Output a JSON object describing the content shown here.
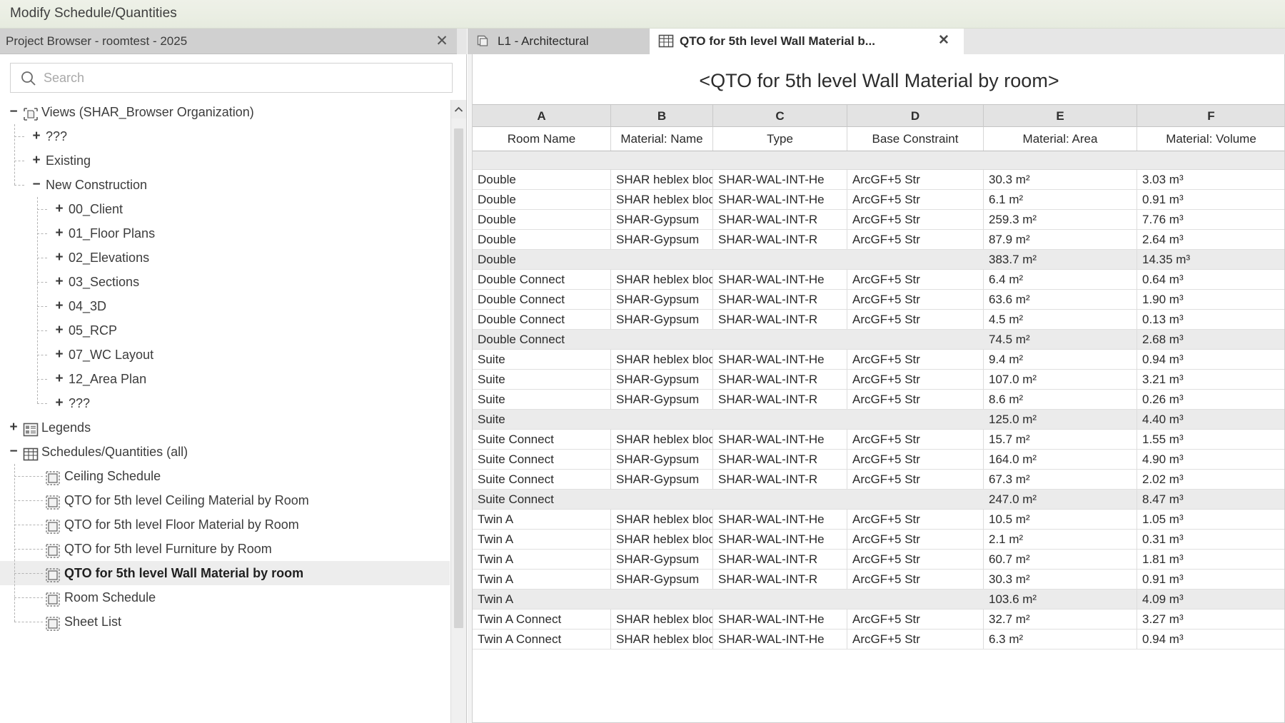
{
  "ribbon": {
    "title": "Modify Schedule/Quantities"
  },
  "browser": {
    "title": "Project Browser - roomtest - 2025",
    "close_label": "✕",
    "search": {
      "placeholder": "Search",
      "value": ""
    },
    "tree": [
      {
        "label": "Views (SHAR_Browser Organization)",
        "expander": "−",
        "depth": 0,
        "icon": "views-icon"
      },
      {
        "label": "???",
        "expander": "+",
        "depth": 1,
        "icon": "none"
      },
      {
        "label": "Existing",
        "expander": "+",
        "depth": 1,
        "icon": "none"
      },
      {
        "label": "New Construction",
        "expander": "−",
        "depth": 1,
        "icon": "none"
      },
      {
        "label": "00_Client",
        "expander": "+",
        "depth": 2,
        "icon": "none"
      },
      {
        "label": "01_Floor Plans",
        "expander": "+",
        "depth": 2,
        "icon": "none"
      },
      {
        "label": "02_Elevations",
        "expander": "+",
        "depth": 2,
        "icon": "none"
      },
      {
        "label": "03_Sections",
        "expander": "+",
        "depth": 2,
        "icon": "none"
      },
      {
        "label": "04_3D",
        "expander": "+",
        "depth": 2,
        "icon": "none"
      },
      {
        "label": "05_RCP",
        "expander": "+",
        "depth": 2,
        "icon": "none"
      },
      {
        "label": "07_WC Layout",
        "expander": "+",
        "depth": 2,
        "icon": "none"
      },
      {
        "label": "12_Area Plan",
        "expander": "+",
        "depth": 2,
        "icon": "none"
      },
      {
        "label": "???",
        "expander": "+",
        "depth": 2,
        "icon": "none"
      },
      {
        "label": "Legends",
        "expander": "+",
        "depth": 0,
        "icon": "legend-icon"
      },
      {
        "label": "Schedules/Quantities (all)",
        "expander": "−",
        "depth": 0,
        "icon": "schedule-icon"
      },
      {
        "label": "Ceiling Schedule",
        "expander": "",
        "depth": 1,
        "icon": "sheet-icon"
      },
      {
        "label": "QTO for 5th level Ceiling Material by Room",
        "expander": "",
        "depth": 1,
        "icon": "sheet-icon"
      },
      {
        "label": "QTO for 5th level Floor Material by Room",
        "expander": "",
        "depth": 1,
        "icon": "sheet-icon"
      },
      {
        "label": "QTO for 5th level Furniture by Room",
        "expander": "",
        "depth": 1,
        "icon": "sheet-icon"
      },
      {
        "label": "QTO for 5th level Wall Material by room",
        "expander": "",
        "depth": 1,
        "icon": "sheet-icon",
        "selected": true
      },
      {
        "label": "Room Schedule",
        "expander": "",
        "depth": 1,
        "icon": "sheet-icon"
      },
      {
        "label": "Sheet List",
        "expander": "",
        "depth": 1,
        "icon": "sheet-icon"
      }
    ]
  },
  "tabs": [
    {
      "label": "L1 - Architectural",
      "icon": "view-sheet-icon",
      "active": false,
      "closable": false
    },
    {
      "label": "QTO for 5th level Wall Material b...",
      "icon": "schedule-grid-icon",
      "active": true,
      "closable": true,
      "close_label": "✕"
    }
  ],
  "schedule": {
    "title": "<QTO for 5th level Wall Material by room>",
    "column_letters": [
      "A",
      "B",
      "C",
      "D",
      "E",
      "F"
    ],
    "columns": [
      "Room Name",
      "Material: Name",
      "Type",
      "Base Constraint",
      "Material: Area",
      "Material: Volume"
    ],
    "rows": [
      {
        "type": "data",
        "cells": [
          "Double",
          "SHAR heblex block",
          "SHAR-WAL-INT-He",
          "ArcGF+5 Str",
          "30.3 m²",
          "3.03 m³"
        ]
      },
      {
        "type": "data",
        "cells": [
          "Double",
          "SHAR heblex block",
          "SHAR-WAL-INT-He",
          "ArcGF+5 Str",
          "6.1 m²",
          "0.91 m³"
        ]
      },
      {
        "type": "data",
        "cells": [
          "Double",
          "SHAR-Gypsum",
          "SHAR-WAL-INT-R",
          "ArcGF+5 Str",
          "259.3 m²",
          "7.76 m³"
        ]
      },
      {
        "type": "data",
        "cells": [
          "Double",
          "SHAR-Gypsum",
          "SHAR-WAL-INT-R",
          "ArcGF+5 Str",
          "87.9 m²",
          "2.64 m³"
        ]
      },
      {
        "type": "subtotal",
        "cells": [
          "Double",
          "",
          "",
          "",
          "383.7 m²",
          "14.35 m³"
        ]
      },
      {
        "type": "data",
        "cells": [
          "Double Connect",
          "SHAR heblex block",
          "SHAR-WAL-INT-He",
          "ArcGF+5 Str",
          "6.4 m²",
          "0.64 m³"
        ]
      },
      {
        "type": "data",
        "cells": [
          "Double Connect",
          "SHAR-Gypsum",
          "SHAR-WAL-INT-R",
          "ArcGF+5 Str",
          "63.6 m²",
          "1.90 m³"
        ]
      },
      {
        "type": "data",
        "cells": [
          "Double Connect",
          "SHAR-Gypsum",
          "SHAR-WAL-INT-R",
          "ArcGF+5 Str",
          "4.5 m²",
          "0.13 m³"
        ]
      },
      {
        "type": "subtotal",
        "cells": [
          "Double Connect",
          "",
          "",
          "",
          "74.5 m²",
          "2.68 m³"
        ]
      },
      {
        "type": "data",
        "cells": [
          "Suite",
          "SHAR heblex block",
          "SHAR-WAL-INT-He",
          "ArcGF+5 Str",
          "9.4 m²",
          "0.94 m³"
        ]
      },
      {
        "type": "data",
        "cells": [
          "Suite",
          "SHAR-Gypsum",
          "SHAR-WAL-INT-R",
          "ArcGF+5 Str",
          "107.0 m²",
          "3.21 m³"
        ]
      },
      {
        "type": "data",
        "cells": [
          "Suite",
          "SHAR-Gypsum",
          "SHAR-WAL-INT-R",
          "ArcGF+5 Str",
          "8.6 m²",
          "0.26 m³"
        ]
      },
      {
        "type": "subtotal",
        "cells": [
          "Suite",
          "",
          "",
          "",
          "125.0 m²",
          "4.40 m³"
        ]
      },
      {
        "type": "data",
        "cells": [
          "Suite Connect",
          "SHAR heblex block",
          "SHAR-WAL-INT-He",
          "ArcGF+5 Str",
          "15.7 m²",
          "1.55 m³"
        ]
      },
      {
        "type": "data",
        "cells": [
          "Suite Connect",
          "SHAR-Gypsum",
          "SHAR-WAL-INT-R",
          "ArcGF+5 Str",
          "164.0 m²",
          "4.90 m³"
        ]
      },
      {
        "type": "data",
        "cells": [
          "Suite Connect",
          "SHAR-Gypsum",
          "SHAR-WAL-INT-R",
          "ArcGF+5 Str",
          "67.3 m²",
          "2.02 m³"
        ]
      },
      {
        "type": "subtotal",
        "cells": [
          "Suite Connect",
          "",
          "",
          "",
          "247.0 m²",
          "8.47 m³"
        ]
      },
      {
        "type": "data",
        "cells": [
          "Twin A",
          "SHAR heblex block",
          "SHAR-WAL-INT-He",
          "ArcGF+5 Str",
          "10.5 m²",
          "1.05 m³"
        ]
      },
      {
        "type": "data",
        "cells": [
          "Twin A",
          "SHAR heblex block",
          "SHAR-WAL-INT-He",
          "ArcGF+5 Str",
          "2.1 m²",
          "0.31 m³"
        ]
      },
      {
        "type": "data",
        "cells": [
          "Twin A",
          "SHAR-Gypsum",
          "SHAR-WAL-INT-R",
          "ArcGF+5 Str",
          "60.7 m²",
          "1.81 m³"
        ]
      },
      {
        "type": "data",
        "cells": [
          "Twin A",
          "SHAR-Gypsum",
          "SHAR-WAL-INT-R",
          "ArcGF+5 Str",
          "30.3 m²",
          "0.91 m³"
        ]
      },
      {
        "type": "subtotal",
        "cells": [
          "Twin A",
          "",
          "",
          "",
          "103.6 m²",
          "4.09 m³"
        ]
      },
      {
        "type": "data",
        "cells": [
          "Twin A Connect",
          "SHAR heblex block",
          "SHAR-WAL-INT-He",
          "ArcGF+5 Str",
          "32.7 m²",
          "3.27 m³"
        ]
      },
      {
        "type": "data",
        "cells": [
          "Twin A Connect",
          "SHAR heblex block",
          "SHAR-WAL-INT-He",
          "ArcGF+5 Str",
          "6.3 m²",
          "0.94 m³"
        ]
      }
    ]
  }
}
